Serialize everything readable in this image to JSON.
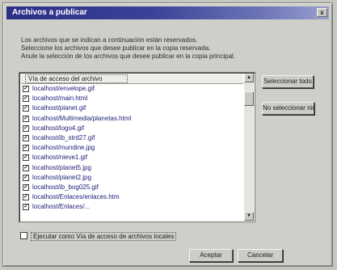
{
  "window": {
    "title": "Archivos a publicar",
    "close_glyph": "x"
  },
  "description": {
    "lines": [
      "Los archivos que se indican a continuación están reservados.",
      "Seleccione los archivos que desee publicar en la copia reservada.",
      "Anule la selección de los archivos que desee publicar en la copia principal."
    ]
  },
  "list": {
    "column_header": "Vía de acceso del archivo",
    "items": [
      {
        "checked": true,
        "path": "localhost/envelope.gif"
      },
      {
        "checked": true,
        "path": "localhost/main.html"
      },
      {
        "checked": true,
        "path": "localhost/planet.gif"
      },
      {
        "checked": true,
        "path": "localhost/Multimedia/planetas.html"
      },
      {
        "checked": true,
        "path": "localhost/logo4.gif"
      },
      {
        "checked": true,
        "path": "localhost/ib_strd27.gif"
      },
      {
        "checked": true,
        "path": "localhost/mundine.jpg"
      },
      {
        "checked": true,
        "path": "localhost/nieve1.gif"
      },
      {
        "checked": true,
        "path": "localhost/planet5.jpg"
      },
      {
        "checked": true,
        "path": "localhost/planet2.jpg"
      },
      {
        "checked": true,
        "path": "localhost/ib_bog025.gif"
      },
      {
        "checked": true,
        "path": "localhost/Enlaces/enlaces.htm"
      },
      {
        "checked": true,
        "path": "localhost/Enlaces/..."
      }
    ],
    "check_glyph": "✓",
    "scroll_up_glyph": "▲",
    "scroll_down_glyph": "▼"
  },
  "buttons": {
    "select_all": "Seleccionar todo",
    "deselect_all": "No seleccionar ninguno",
    "accept": "Aceptar",
    "cancel": "Cancelar"
  },
  "footer": {
    "checkbox_label": "Ejecutar como Vía de acceso de archivos locales",
    "checked": false
  }
}
